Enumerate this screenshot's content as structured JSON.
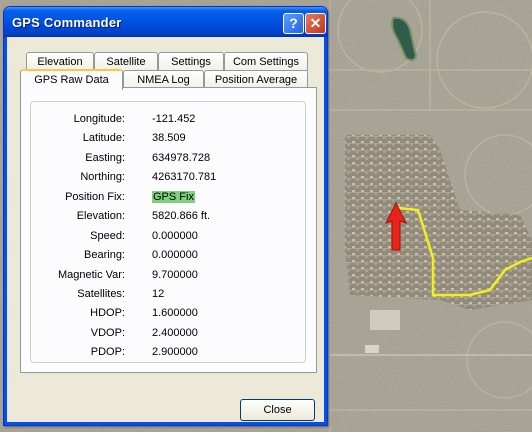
{
  "window": {
    "title": "GPS Commander"
  },
  "title_buttons": {
    "help": "?",
    "close": "✕"
  },
  "tabs_row1": [
    "Elevation",
    "Satellite",
    "Settings",
    "Com Settings"
  ],
  "tabs_row2": [
    "GPS Raw Data",
    "NMEA Log",
    "Position Average"
  ],
  "active_tab": "GPS Raw Data",
  "fields": [
    {
      "label": "Longitude:",
      "value": "-121.452"
    },
    {
      "label": "Latitude:",
      "value": "38.509"
    },
    {
      "label": "Easting:",
      "value": "634978.728"
    },
    {
      "label": "Northing:",
      "value": "4263170.781"
    },
    {
      "label": "Position Fix:",
      "value": "GPS Fix"
    },
    {
      "label": "Elevation:",
      "value": "5820.866 ft."
    },
    {
      "label": "Speed:",
      "value": "0.000000"
    },
    {
      "label": "Bearing:",
      "value": "0.000000"
    },
    {
      "label": "Magnetic Var:",
      "value": "9.700000"
    },
    {
      "label": "Satellites:",
      "value": "12"
    },
    {
      "label": "HDOP:",
      "value": "1.600000"
    },
    {
      "label": "VDOP:",
      "value": "2.400000"
    },
    {
      "label": "PDOP:",
      "value": "2.900000"
    }
  ],
  "buttons": {
    "close": "Close"
  },
  "colors": {
    "titlebar": "#0055e5",
    "fix_highlight": "#7fd07a",
    "track": "#f2ef1a",
    "position_arrow": "#e8241a"
  },
  "map": {
    "icons": [
      "track-line",
      "position-arrow"
    ]
  }
}
